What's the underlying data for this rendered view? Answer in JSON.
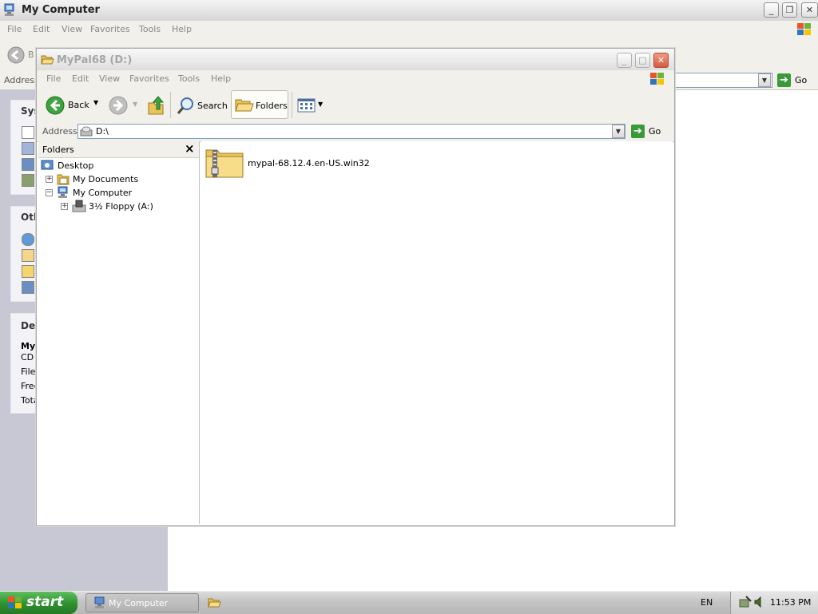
{
  "background_window": {
    "title": "My Computer",
    "menu": [
      "File",
      "Edit",
      "View",
      "Favorites",
      "Tools",
      "Help"
    ],
    "back_label_fragment": "B",
    "address_label": "Address",
    "go_label": "Go",
    "task_panels": [
      {
        "heading": "Sys",
        "rows": 4
      },
      {
        "heading": "Oth",
        "rows": 4
      },
      {
        "heading": "Det",
        "lines": [
          "My",
          "CD",
          "File",
          "Free",
          "Tota"
        ]
      }
    ]
  },
  "window": {
    "title": "MyPal68 (D:)",
    "menu": [
      "File",
      "Edit",
      "View",
      "Favorites",
      "Tools",
      "Help"
    ],
    "toolbar": {
      "back_label": "Back",
      "search_label": "Search",
      "folders_label": "Folders"
    },
    "address": {
      "label": "Address",
      "value": "D:\\",
      "go_label": "Go"
    },
    "folders_pane": {
      "heading": "Folders",
      "close_glyph": "×",
      "tree": [
        {
          "label": "Desktop",
          "level": 0,
          "expander": "",
          "icon": "desktop-icon"
        },
        {
          "label": "My Documents",
          "level": 1,
          "expander": "+",
          "icon": "my-documents-icon"
        },
        {
          "label": "My Computer",
          "level": 1,
          "expander": "−",
          "icon": "my-computer-icon"
        },
        {
          "label": "3½ Floppy (A:)",
          "level": 2,
          "expander": "+",
          "icon": "floppy-drive-icon"
        }
      ]
    },
    "files": [
      {
        "name": "mypal-68.12.4.en-US.win32",
        "icon": "zip-folder-icon"
      }
    ]
  },
  "taskbar": {
    "start_label": "start",
    "tasks": [
      {
        "label": "My Computer",
        "icon": "my-computer-icon"
      },
      {
        "label": "",
        "icon": "folder-icon"
      }
    ],
    "language": "EN",
    "clock": "11:53 PM"
  },
  "colors": {
    "start_green": "#2e8f2e",
    "go_green": "#3a9a3a",
    "selection_blue": "#316ac5"
  }
}
